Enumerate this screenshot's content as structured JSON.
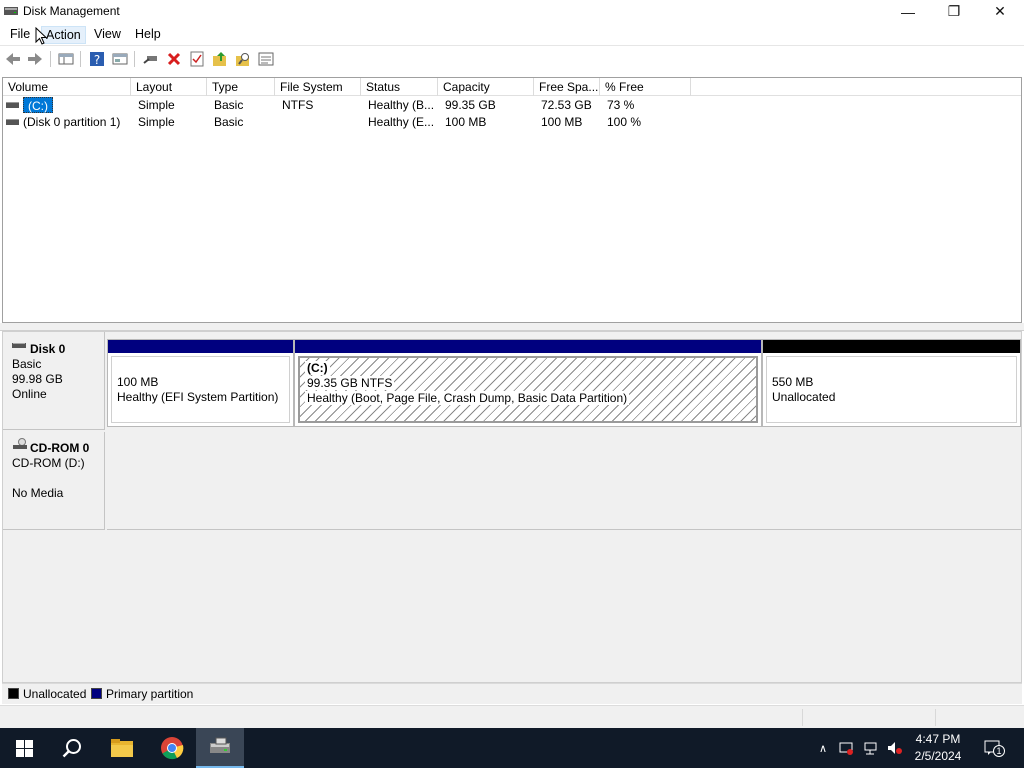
{
  "window": {
    "title": "Disk Management",
    "icon": "disk-management-icon",
    "controls": [
      "minimize-icon",
      "restore-icon",
      "close-icon"
    ]
  },
  "menu": {
    "items": [
      {
        "label": "File"
      },
      {
        "label": "Action"
      },
      {
        "label": "View"
      },
      {
        "label": "Help"
      }
    ]
  },
  "toolbar": {
    "buttons": [
      "back-icon",
      "forward-icon",
      "show-hide-console-tree-icon",
      "help-icon",
      "properties-icon",
      "connect-icon",
      "delete-icon",
      "check-icon",
      "export-icon",
      "search-icon",
      "list-icon"
    ]
  },
  "volumes": {
    "columns": [
      "Volume",
      "Layout",
      "Type",
      "File System",
      "Status",
      "Capacity",
      "Free Spa...",
      "% Free"
    ],
    "rows": [
      {
        "volume": "(C:)",
        "layout": "Simple",
        "type": "Basic",
        "fs": "NTFS",
        "status": "Healthy (B...",
        "capacity": "99.35 GB",
        "free": "72.53 GB",
        "pct": "73 %"
      },
      {
        "volume": "(Disk 0 partition 1)",
        "layout": "Simple",
        "type": "Basic",
        "fs": "",
        "status": "Healthy (E...",
        "capacity": "100 MB",
        "free": "100 MB",
        "pct": "100 %"
      }
    ]
  },
  "disks": [
    {
      "name": "Disk 0",
      "type": "Basic",
      "size": "99.98 GB",
      "state": "Online",
      "partitions": [
        {
          "title": "",
          "size": "100 MB",
          "status": "Healthy (EFI System Partition)",
          "kind": "primary"
        },
        {
          "title": "(C:)",
          "size": "99.35 GB NTFS",
          "status": "Healthy (Boot, Page File, Crash Dump, Basic Data Partition)",
          "kind": "primary"
        },
        {
          "title": "",
          "size": "550 MB",
          "status": "Unallocated",
          "kind": "unallocated"
        }
      ]
    },
    {
      "name": "CD-ROM 0",
      "type": "CD-ROM (D:)",
      "state": "No Media"
    }
  ],
  "legend": [
    {
      "label": "Unallocated",
      "color": "#000000"
    },
    {
      "label": "Primary partition",
      "color": "#00007f"
    }
  ],
  "taskbar": {
    "apps": [
      "windows-start-icon",
      "search-icon",
      "file-explorer-icon",
      "chrome-icon",
      "disk-management-icon"
    ],
    "tray": [
      "chevron-up-icon",
      "network-alert-icon",
      "network-icon",
      "volume-muted-icon"
    ],
    "time": "4:47 PM",
    "date": "2/5/2024",
    "notifications": "1"
  },
  "colors": {
    "primary_partition": "#00007f",
    "unallocated": "#000000",
    "selection": "#0078d7",
    "taskbar": "#101a28"
  }
}
